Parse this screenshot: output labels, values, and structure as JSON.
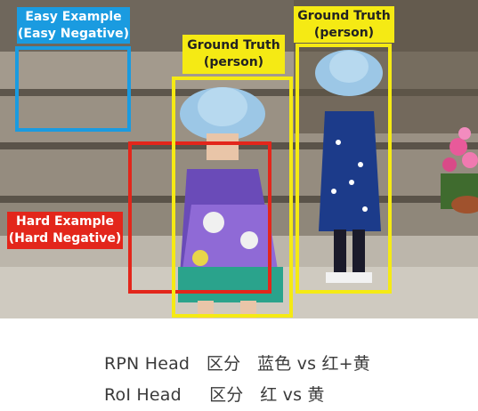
{
  "labels": {
    "easy": {
      "line1": "Easy Example",
      "line2": "(Easy Negative)"
    },
    "hard": {
      "line1": "Hard Example",
      "line2": "(Hard Negative)"
    },
    "gt_left": {
      "line1": "Ground Truth",
      "line2": "(person)"
    },
    "gt_right": {
      "line1": "Ground Truth",
      "line2": "(person)"
    }
  },
  "caption": {
    "line1": "RPN Head   区分   蓝色 vs 红+黄",
    "line2": "RoI Head     区分   红 vs 黄"
  },
  "colors": {
    "easy_box": "#1a9be0",
    "hard_box": "#e3261b",
    "ground_truth_box": "#f5ea14"
  }
}
